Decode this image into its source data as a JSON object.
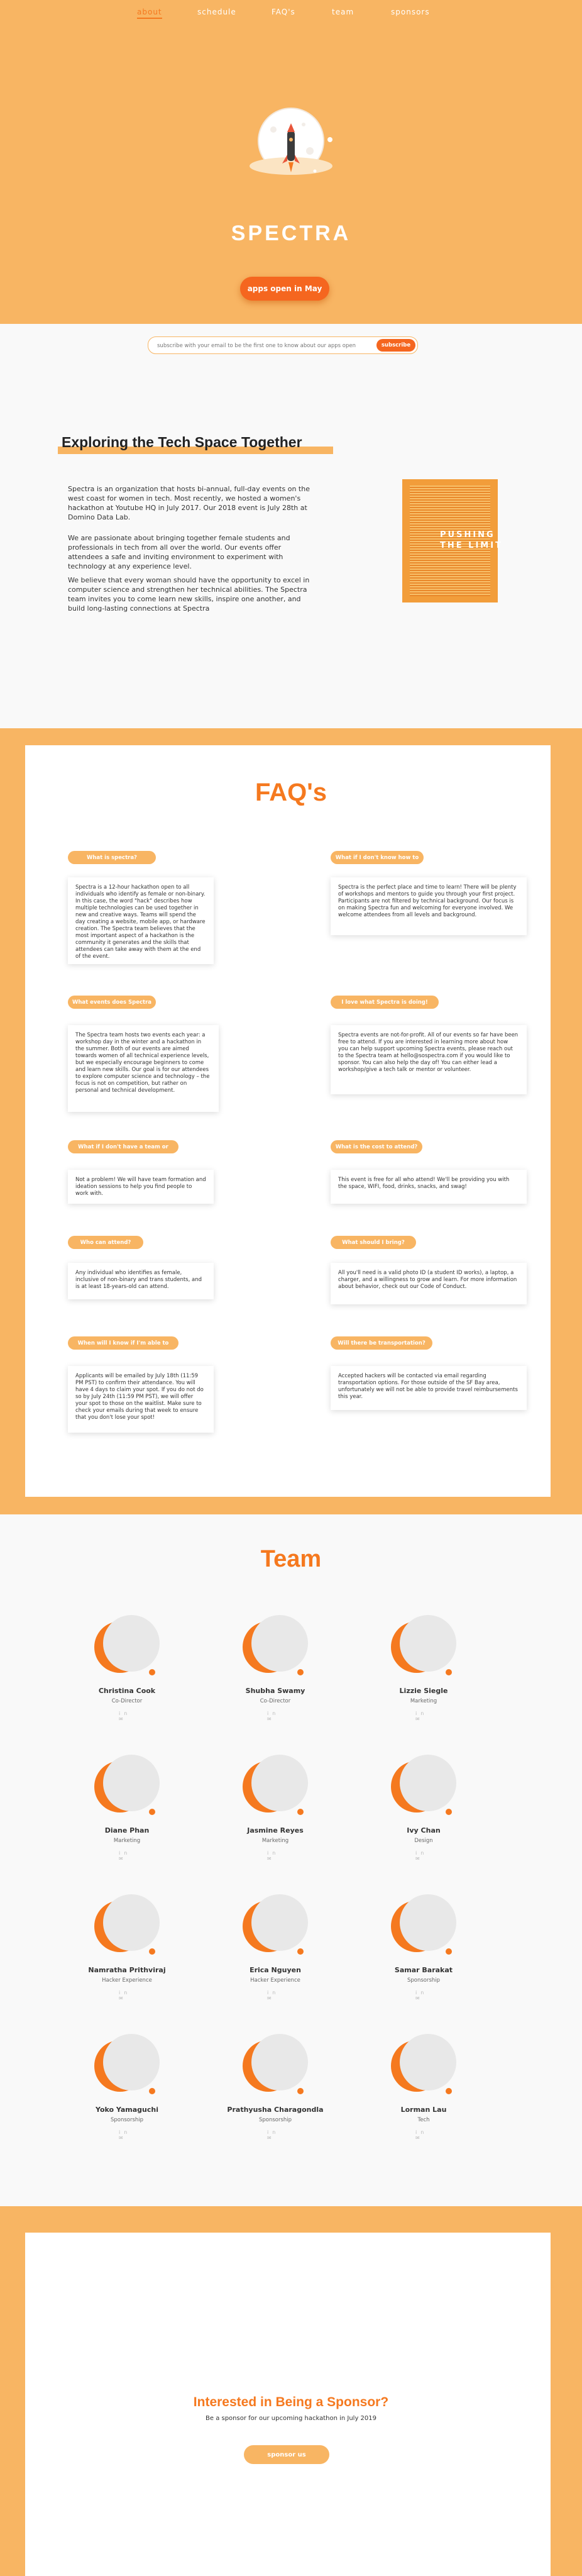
{
  "nav": {
    "items": [
      "about",
      "schedule",
      "FAQ's",
      "team",
      "sponsors"
    ],
    "active": "about"
  },
  "hero": {
    "brand": "SPECTRA",
    "apps_button": "apps open in May",
    "logo_icon": "rocket-moon-icon"
  },
  "subscribe": {
    "placeholder": "subscribe with your email to be the first one to know about our apps open",
    "button": "subscribe"
  },
  "about": {
    "title": "Exploring the Tech Space Together",
    "paragraphs": [
      "Spectra is an organization that hosts bi-annual, full-day events on the west coast for women in tech. Most recently, we hosted a women's hackathon at Youtube HQ in July 2017. Our 2018 event is July 28th at Domino Data Lab.",
      "We are passionate about bringing together female students and professionals in tech from all over the world. Our events offer attendees a safe and inviting environment to experiment with technology at any experience level.",
      "We believe that every woman should have the opportunity to excel in computer science and strengthen her technical abilities. The Spectra team invites you to come learn new skills, inspire one another, and build long-lasting connections at Spectra"
    ],
    "poster_text": "PUSHING THE LIMIT"
  },
  "faq": {
    "title": "FAQ's",
    "items": [
      {
        "q": "What is spectra?",
        "a": "Spectra is a 12-hour hackathon open to all individuals who identify as female or non-binary. In this case, the word \"hack\" describes how multiple technologies can be used together in new and creative ways. Teams will spend the day creating a website, mobile app, or hardware creation. The Spectra team believes that the most important aspect of a hackathon is the community it generates and the skills that attendees can take away with them at the end of the event."
      },
      {
        "q": "What if I don't know how to code?",
        "a": "Spectra is the perfect place and time to learn! There will be plenty of workshops and mentors to guide you through your first project. Participants are not filtered by technical background. Our focus is on making Spectra fun and welcoming for everyone involved. We welcome attendees from all levels and background."
      },
      {
        "q": "What events does Spectra host?",
        "a": "The Spectra team hosts two events each year: a workshop day in the winter and a hackathon in the summer. Both of our events are aimed towards women of all technical experience levels, but we especially encourage beginners to come and learn new skills. Our goal is for our attendees to explore computer science and technology – the focus is not on competition, but rather on personal and technical development."
      },
      {
        "q": "I love what Spectra is doing! How can I help?",
        "a": "Spectra events are not-for-profit. All of our events so far have been free to attend. If you are interested in learning more about how you can help support upcoming Spectra events, please reach out to the Spectra team at hello@sospectra.com if you would like to sponsor. You can also help the day of! You can either lead a workshop/give a tech talk or mentor or volunteer."
      },
      {
        "q": "What if I don't have a team or idea yet?",
        "a": "Not a problem! We will have team formation and ideation sessions to help you find people to work with."
      },
      {
        "q": "What is the cost to attend?",
        "a": "This event is free for all who attend! We'll be providing you with the space, WIFI, food, drinks, snacks, and swag!"
      },
      {
        "q": "Who can attend?",
        "a": "Any individual who identifies as female, inclusive of non-binary and trans students, and is at least 18-years-old can attend."
      },
      {
        "q": "What should I bring?",
        "a": "All you'll need is a valid photo ID (a student ID works), a laptop, a charger, and a willingness to grow and learn. For more information about behavior, check out our Code of Conduct."
      },
      {
        "q": "When will I know if I'm able to attend?",
        "a": "Applicants will be emailed by July 18th (11:59 PM PST) to confirm their attendance. You will have 4 days to claim your spot. If you do not do so by July 24th (11:59 PM PST), we will offer your spot to those on the waitlist. Make sure to check your emails during that week to ensure that you don't lose your spot!"
      },
      {
        "q": "Will there be transportation?",
        "a": "Accepted hackers will be contacted via email regarding transportation options. For those outside of the SF Bay area, unfortunately we will not be able to provide travel reimbursements this year."
      }
    ]
  },
  "team": {
    "title": "Team",
    "members": [
      {
        "name": "Christina Cook",
        "role": "Co-Director"
      },
      {
        "name": "Shubha Swamy",
        "role": "Co-Director"
      },
      {
        "name": "Lizzie Siegle",
        "role": "Marketing"
      },
      {
        "name": "Diane Phan",
        "role": "Marketing"
      },
      {
        "name": "Jasmine Reyes",
        "role": "Marketing"
      },
      {
        "name": "Ivy Chan",
        "role": "Design"
      },
      {
        "name": "Namratha Prithviraj",
        "role": "Hacker Experience"
      },
      {
        "name": "Erica Nguyen",
        "role": "Hacker Experience"
      },
      {
        "name": "Samar Barakat",
        "role": "Sponsorship"
      },
      {
        "name": "Yoko Yamaguchi",
        "role": "Sponsorship"
      },
      {
        "name": "Prathyusha Charagondla",
        "role": "Sponsorship"
      },
      {
        "name": "Lorman Lau",
        "role": "Tech"
      }
    ]
  },
  "sponsor": {
    "title": "Interested in Being a Sponsor?",
    "subtitle": "Be a sponsor for our upcoming hackathon in July 2019",
    "button": "sponsor us"
  },
  "colors": {
    "peach": "#f8b563",
    "orange": "#f5791f",
    "cta": "#f5661f",
    "bg": "#f9f9f9"
  }
}
